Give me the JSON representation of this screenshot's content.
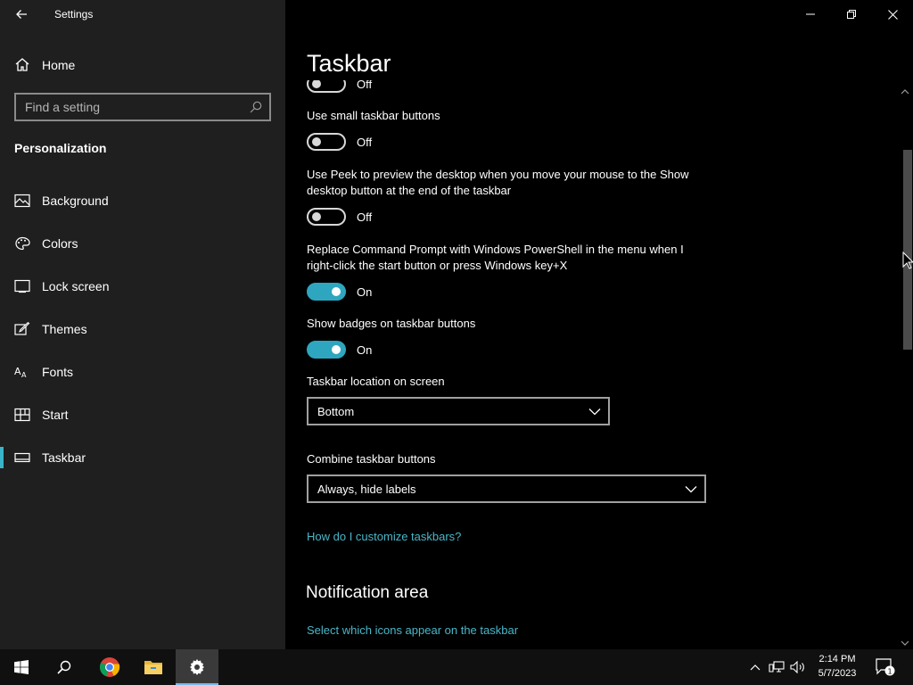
{
  "window": {
    "title": "Settings"
  },
  "sidebar": {
    "home_label": "Home",
    "search_placeholder": "Find a setting",
    "section_title": "Personalization",
    "items": [
      {
        "label": "Background",
        "icon": "picture-icon"
      },
      {
        "label": "Colors",
        "icon": "palette-icon"
      },
      {
        "label": "Lock screen",
        "icon": "lock-screen-icon"
      },
      {
        "label": "Themes",
        "icon": "brush-icon"
      },
      {
        "label": "Fonts",
        "icon": "font-icon"
      },
      {
        "label": "Start",
        "icon": "start-layout-icon"
      },
      {
        "label": "Taskbar",
        "icon": "taskbar-icon",
        "active": true
      }
    ]
  },
  "main": {
    "title": "Taskbar",
    "partial_toggle": {
      "state": "Off"
    },
    "settings": [
      {
        "label": "Use small taskbar buttons",
        "state": "Off",
        "on": false
      },
      {
        "label": "Use Peek to preview the desktop when you move your mouse to the Show desktop button at the end of the taskbar",
        "state": "Off",
        "on": false
      },
      {
        "label": "Replace Command Prompt with Windows PowerShell in the menu when I right-click the start button or press Windows key+X",
        "state": "On",
        "on": true
      },
      {
        "label": "Show badges on taskbar buttons",
        "state": "On",
        "on": true
      }
    ],
    "location": {
      "label": "Taskbar location on screen",
      "value": "Bottom"
    },
    "combine": {
      "label": "Combine taskbar buttons",
      "value": "Always, hide labels"
    },
    "customize_link": "How do I customize taskbars?",
    "notification_area": {
      "heading": "Notification area",
      "link": "Select which icons appear on the taskbar"
    }
  },
  "taskbar": {
    "time": "2:14 PM",
    "date": "5/7/2023",
    "notification_count": "1"
  },
  "colors": {
    "accent": "#2ea6c0",
    "link": "#49b6c8",
    "sidebar_bg": "#1f1f1f",
    "main_bg": "#000000"
  }
}
